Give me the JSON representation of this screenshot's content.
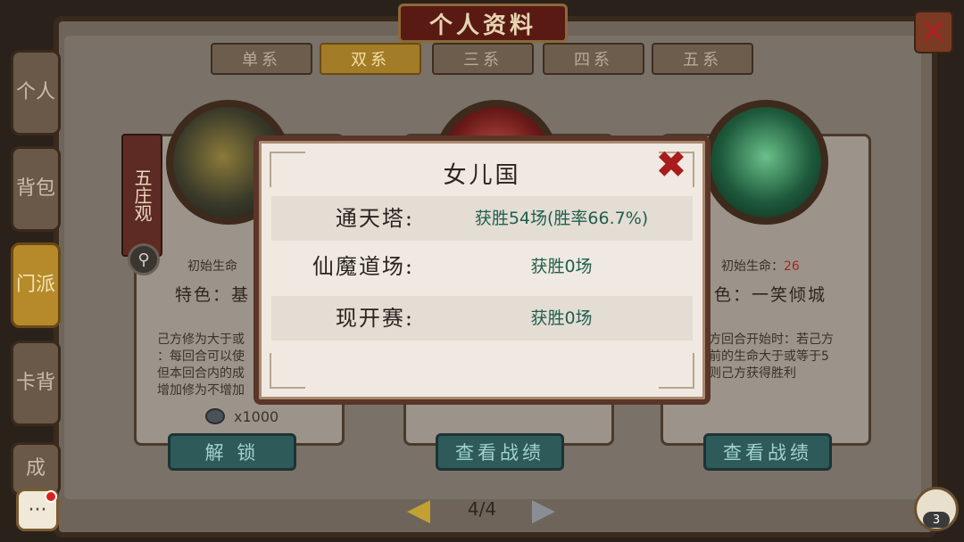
{
  "header": {
    "title": "个人资料",
    "close_icon": "close-icon"
  },
  "side_tabs": [
    {
      "label": "个人",
      "active": false
    },
    {
      "label": "背包",
      "active": false
    },
    {
      "label": "门派",
      "active": true
    },
    {
      "label": "卡背",
      "active": false
    },
    {
      "label": "成",
      "active": false
    }
  ],
  "top_tabs": [
    {
      "label": "单系",
      "active": false
    },
    {
      "label": "双系",
      "active": true
    },
    {
      "label": "三系",
      "active": false
    },
    {
      "label": "四系",
      "active": false
    },
    {
      "label": "五系",
      "active": false
    }
  ],
  "cards": [
    {
      "sect_tag": "五庄观",
      "initial_life_label": "初始生命",
      "feature_label": "特色：",
      "feature_text": "基",
      "desc_lines": [
        "己方修为大于或",
        "：每回合可以使",
        "但本回合内的成",
        "增加修为不增加"
      ],
      "cost": "x1000",
      "button": "解 锁"
    },
    {
      "button": "查看战绩"
    },
    {
      "initial_life_label": "初始生命：",
      "initial_life_value": "26",
      "feature_label": "色：",
      "feature_text": "一笑倾城",
      "desc_lines": [
        "方回合开始时：若己方",
        "前的生命大于或等于5",
        "则己方获得胜利"
      ],
      "button": "查看战绩"
    }
  ],
  "pager": {
    "text": "4/4"
  },
  "modal": {
    "title": "女儿国",
    "rows": [
      {
        "label": "通天塔:",
        "value": "获胜54场(胜率66.7%)"
      },
      {
        "label": "仙魔道场:",
        "value": "获胜0场"
      },
      {
        "label": "现开赛:",
        "value": "获胜0场"
      }
    ]
  },
  "friends_count": "3",
  "colors": {
    "accent_gold": "#b68a2a",
    "button_teal": "#2f5a5a",
    "value_green": "#1f5e4e",
    "close_red": "#a81c1c"
  }
}
